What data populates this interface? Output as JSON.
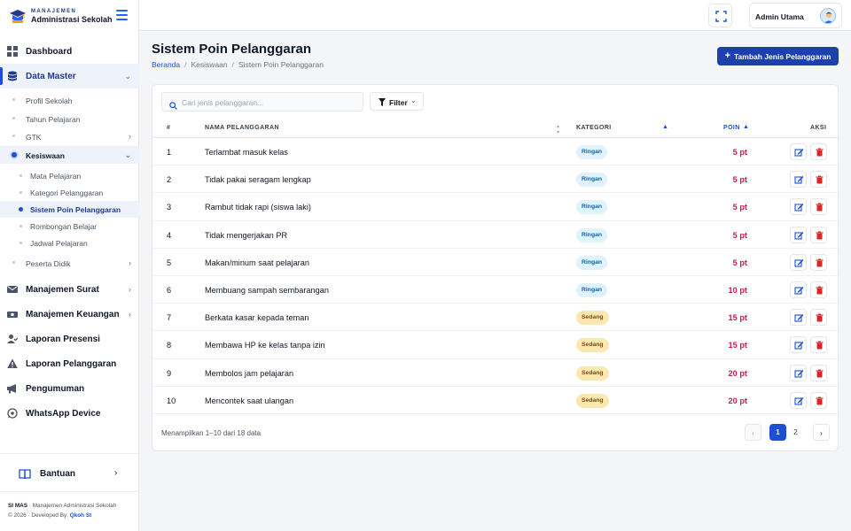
{
  "brand": {
    "line1": "MANAJEMEN",
    "line2": "Administrasi Sekolah"
  },
  "sidebar": {
    "items": [
      {
        "label": "Dashboard",
        "icon": "grid-icon"
      },
      {
        "label": "Data Master",
        "icon": "database-icon"
      },
      {
        "label": "Manajemen Surat",
        "icon": "envelope-icon"
      },
      {
        "label": "Manajemen Keuangan",
        "icon": "money-icon"
      },
      {
        "label": "Laporan Presensi",
        "icon": "user-check-icon"
      },
      {
        "label": "Laporan Pelanggaran",
        "icon": "warning-icon"
      },
      {
        "label": "Pengumuman",
        "icon": "megaphone-icon"
      },
      {
        "label": "WhatsApp Device",
        "icon": "whatsapp-icon"
      }
    ],
    "data_master_sub": [
      "Profil Sekolah",
      "Tahun Pelajaran",
      "GTK",
      "Kesiswaan"
    ],
    "kesiswaan_sub": [
      "Mata Pelajaran",
      "Kategori Pelanggaran",
      "Sistem Poin Pelanggaran",
      "Rombongan Belajar",
      "Jadwal Pelajaran"
    ],
    "peserta_didik": "Peserta Didik",
    "help": "Bantuan",
    "footer": {
      "app": "SI MAS",
      "desc": " · Manajemen Administrasi Sekolah",
      "copy": "© 2026 · Developed By: ",
      "dev": "Qkoh St"
    }
  },
  "topbar": {
    "user_name": "Admin Utama"
  },
  "page": {
    "title": "Sistem Poin Pelanggaran",
    "breadcrumb": [
      "Beranda",
      "Kesiswaan",
      "Sistem Poin Pelanggaran"
    ],
    "add_button": "Tambah Jenis Pelanggaran"
  },
  "toolbar": {
    "search_placeholder": "Cari jenis pelanggaran...",
    "filter_label": "Filter"
  },
  "table": {
    "columns": [
      "#",
      "NAMA PELANGGARAN",
      "KATEGORI",
      "POIN",
      "AKSI"
    ],
    "rows": [
      {
        "no": "1",
        "name": "Terlambat masuk kelas",
        "category": "Ringan",
        "points": "5 pt"
      },
      {
        "no": "2",
        "name": "Tidak pakai seragam lengkap",
        "category": "Ringan",
        "points": "5 pt"
      },
      {
        "no": "3",
        "name": "Rambut tidak rapi (siswa laki)",
        "category": "Ringan",
        "points": "5 pt"
      },
      {
        "no": "4",
        "name": "Tidak mengerjakan PR",
        "category": "Ringan",
        "points": "5 pt"
      },
      {
        "no": "5",
        "name": "Makan/minum saat pelajaran",
        "category": "Ringan",
        "points": "5 pt"
      },
      {
        "no": "6",
        "name": "Membuang sampah sembarangan",
        "category": "Ringan",
        "points": "10 pt"
      },
      {
        "no": "7",
        "name": "Berkata kasar kepada teman",
        "category": "Sedang",
        "points": "15 pt"
      },
      {
        "no": "8",
        "name": "Membawa HP ke kelas tanpa izin",
        "category": "Sedang",
        "points": "15 pt"
      },
      {
        "no": "9",
        "name": "Membolos jam pelajaran",
        "category": "Sedang",
        "points": "20 pt"
      },
      {
        "no": "10",
        "name": "Mencontek saat ulangan",
        "category": "Sedang",
        "points": "20 pt"
      }
    ]
  },
  "pagination": {
    "info": "Menampilkan 1–10 dari 18 data",
    "pages": [
      "1",
      "2"
    ],
    "prev": "‹",
    "next": "›"
  },
  "colors": {
    "accent": "#1e40af",
    "points": "#c81e4a",
    "ringan_bg": "#e0f2fe",
    "sedang_bg": "#fde7b0"
  }
}
